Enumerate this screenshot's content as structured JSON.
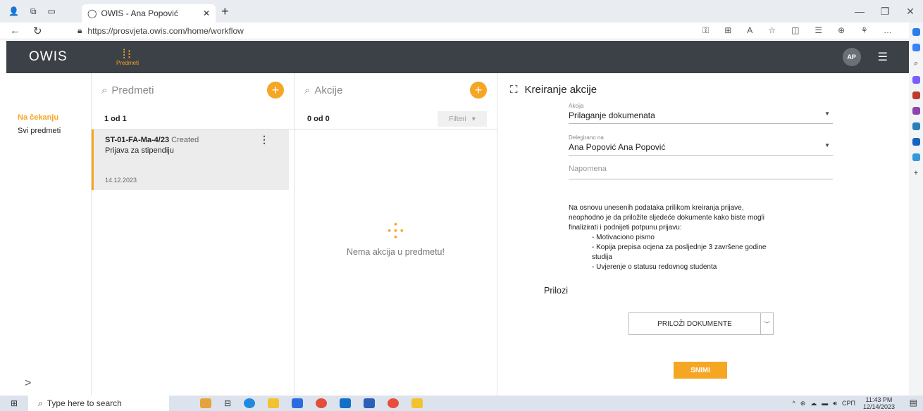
{
  "browser": {
    "tab_title": "OWIS - Ana Popović",
    "url": "https://prosvjeta.owis.com/home/workflow"
  },
  "app": {
    "logo": "OWIS",
    "module_label": "Predmeti",
    "avatar_initials": "AP",
    "accent_color": "#f5a623",
    "header_color": "#3c4047"
  },
  "sidebar": {
    "items": [
      {
        "label": "Na čekanju",
        "active": true
      },
      {
        "label": "Svi predmeti",
        "active": false
      }
    ]
  },
  "predmeti": {
    "search_placeholder": "Predmeti",
    "count": "1 od 1",
    "cards": [
      {
        "code": "ST-01-FA-Ma-4/23",
        "status": "Created",
        "name": "Prijava za stipendiju",
        "date": "14.12.2023"
      }
    ]
  },
  "akcije": {
    "search_placeholder": "Akcije",
    "count": "0 od 0",
    "filter_label": "Filteri",
    "empty_message": "Nema akcija u predmetu!"
  },
  "form": {
    "title": "Kreiranje akcije",
    "akcija_label": "Akcija",
    "akcija_value": "Prilaganje dokumenata",
    "delegirano_label": "Delegirano na",
    "delegirano_value": "Ana Popović Ana Popović",
    "napomena_placeholder": "Napomena",
    "info_lines": [
      "Na osnovu unesenih podataka prilikom kreiranja prijave,",
      "neophodno je da priložite sljedeće dokumente kako biste mogli",
      "finalizirati i podnijeti potpunu prijavu:"
    ],
    "info_items": [
      "- Motivaciono pismo",
      "- Kopija prepisa ocjena za posljednje 3 završene godine",
      "studija",
      "- Uvjerenje o statusu redovnog studenta"
    ],
    "prilozi_label": "Prilozi",
    "attach_button": "PRILOŽI DOKUMENTE",
    "save_button": "SNIMI"
  },
  "taskbar": {
    "search_placeholder": "Type here to search",
    "language": "СРП",
    "time": "11:43 PM",
    "date": "12/14/2023"
  }
}
